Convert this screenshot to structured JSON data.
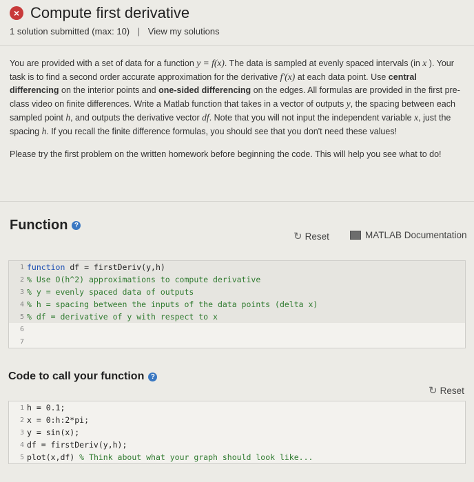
{
  "header": {
    "status_icon": "x-circle-icon",
    "title": "Compute first derivative",
    "submitted": "1 solution submitted (max: 10)",
    "separator": "|",
    "view_solutions": "View my solutions"
  },
  "description": {
    "p1_a": "You are provided with a set of data for a function",
    "p1_math1": "y = f(x)",
    "p1_b": ". The data is sampled at evenly spaced intervals (in",
    "p1_math2": "x",
    "p1_c": "). Your task is to find a second order accurate approximation for the derivative",
    "p1_math3": "f′(x)",
    "p1_d": "at each data point. Use",
    "p1_bold1": "central differencing",
    "p1_e": "on the interior points and",
    "p1_bold2": "one-sided differencing",
    "p1_f": "on the edges. All formulas are provided in the first pre-class video on finite differences. Write a Matlab function that takes in a vector of outputs",
    "p1_math4": "y",
    "p1_g": ", the spacing between each sampled point",
    "p1_math5": "h",
    "p1_h": ", and outputs the derivative vector",
    "p1_math6": "df",
    "p1_i": ". Note that you will not input the independent variable",
    "p1_math7": "x",
    "p1_j": ", just the spacing",
    "p1_math8": "h",
    "p1_k": ". If you recall the finite difference formulas, you should see that you don't need these values!",
    "p2": "Please try the first problem on the written homework before beginning the code. This will help you see what to do!"
  },
  "function_section": {
    "title": "Function",
    "help_icon": "question-circle-icon",
    "reset_label": "Reset",
    "docs_label": "MATLAB Documentation",
    "lines": [
      {
        "n": "1",
        "kw": "function",
        "text": " df = firstDeriv(y,h)"
      },
      {
        "n": "2",
        "cm": "% Use O(h^2) approximations to compute derivative"
      },
      {
        "n": "3",
        "cm": "% y = evenly spaced data of outputs"
      },
      {
        "n": "4",
        "cm": "% h = spacing between the inputs of the data points (delta x)"
      },
      {
        "n": "5",
        "cm": "% df = derivative of y with respect to x"
      },
      {
        "n": "6",
        "text": ""
      },
      {
        "n": "7",
        "text": ""
      }
    ]
  },
  "call_section": {
    "title": "Code to call your function",
    "help_icon": "question-circle-icon",
    "reset_label": "Reset",
    "lines": [
      {
        "n": "1",
        "text": "h = 0.1;"
      },
      {
        "n": "2",
        "text": "x = 0:h:2*pi;"
      },
      {
        "n": "3",
        "text": "y = sin(x);"
      },
      {
        "n": "4",
        "text": "df = firstDeriv(y,h);"
      },
      {
        "n": "5",
        "text": "plot(x,df) ",
        "cm": "% Think about what your graph should look like..."
      }
    ]
  }
}
